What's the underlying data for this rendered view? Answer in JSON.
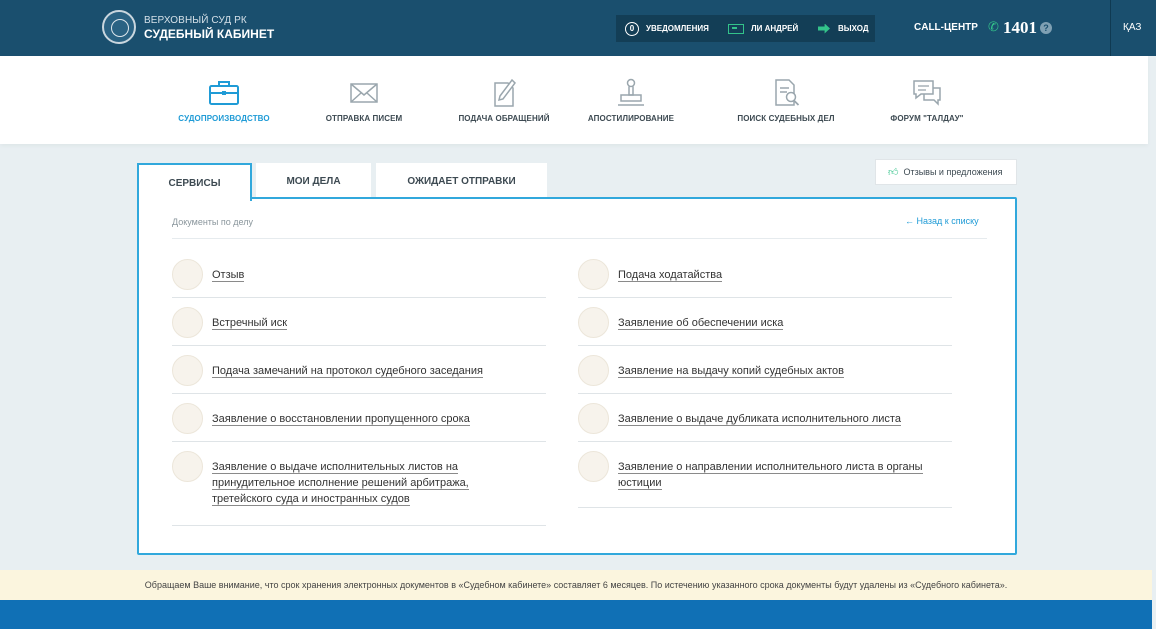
{
  "header": {
    "brand_small": "ВЕРХОВНЫЙ СУД РК",
    "brand_big": "СУДЕБНЫЙ КАБИНЕТ",
    "notif_count": "0",
    "notifications": "УВЕДОМЛЕНИЯ",
    "user": "ЛИ АНДРЕЙ",
    "logout": "ВЫХОД",
    "call_center": "CALL-ЦЕНТР",
    "phone": "1401",
    "help": "?",
    "lang": "ҚАЗ"
  },
  "nav": [
    {
      "label": "СУДОПРОИЗВОДСТВО",
      "icon": "briefcase-icon"
    },
    {
      "label": "ОТПРАВКА ПИСЕМ",
      "icon": "envelope-icon"
    },
    {
      "label": "ПОДАЧА ОБРАЩЕНИЙ",
      "icon": "document-edit-icon"
    },
    {
      "label": "АПОСТИЛИРОВАНИЕ",
      "icon": "stamp-icon"
    },
    {
      "label": "ПОИСК СУДЕБНЫХ ДЕЛ",
      "icon": "document-search-icon"
    },
    {
      "label": "ФОРУМ \"ТАЛДАУ\"",
      "icon": "chat-icon"
    }
  ],
  "tabs": [
    "СЕРВИСЫ",
    "МОИ ДЕЛА",
    "ОЖИДАЕТ ОТПРАВКИ"
  ],
  "feedback": "Отзывы и предложения",
  "card": {
    "subtitle": "Документы по делу",
    "back": "← Назад к списку"
  },
  "docs_left": [
    "Отзыв",
    "Встречный иск",
    "Подача замечаний на протокол судебного заседания",
    "Заявление о восстановлении пропущенного срока",
    [
      "Заявление о выдаче исполнительных листов на",
      "принудительное исполнение решений арбитража,",
      "третейского суда и иностранных судов"
    ]
  ],
  "docs_right": [
    "Подача ходатайства",
    "Заявление об обеспечении иска",
    "Заявление на выдачу копий судебных актов",
    "Заявление о выдаче дубликата исполнительного листа",
    [
      "Заявление о направлении исполнительного листа в органы",
      "юстиции"
    ]
  ],
  "notice": "Обращаем Ваше внимание, что срок хранения электронных документов в «Судебном кабинете» составляет 6 месяцев. По истечению указанного срока документы будут удалены из «Судебного кабинета».",
  "colors": {
    "header": "#1a4f6e",
    "accent": "#1f9bd6",
    "green": "#33c38a",
    "footer": "#1070b5"
  }
}
